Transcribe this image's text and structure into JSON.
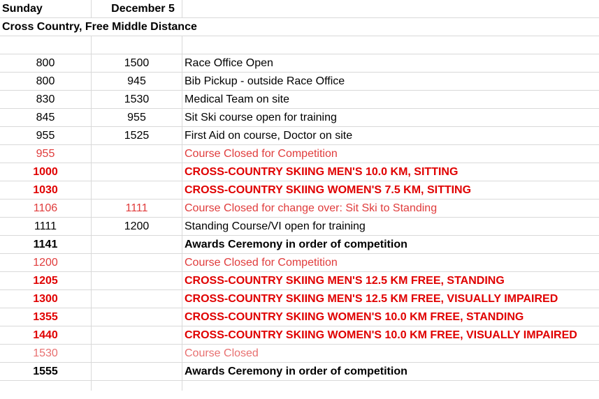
{
  "header": {
    "day": "Sunday",
    "date": "December 5"
  },
  "subtitle": "Cross Country, Free Middle Distance",
  "colors": {
    "black": "#000000",
    "red": "#e00000",
    "lightred": "#e03c3c",
    "pink": "#e87070"
  },
  "rows": [
    {
      "start": "800",
      "end": "1500",
      "event": "Race Office Open",
      "style": "black",
      "bold": false
    },
    {
      "start": "800",
      "end": "945",
      "event": "Bib Pickup - outside Race Office",
      "style": "black",
      "bold": false
    },
    {
      "start": "830",
      "end": "1530",
      "event": "Medical Team on site",
      "style": "black",
      "bold": false
    },
    {
      "start": "845",
      "end": "955",
      "event": "Sit Ski course open for training",
      "style": "black",
      "bold": false
    },
    {
      "start": "955",
      "end": "1525",
      "event": "First Aid on course, Doctor on site",
      "style": "black",
      "bold": false
    },
    {
      "start": "955",
      "end": "",
      "event": "Course Closed for Competition",
      "style": "lightred",
      "bold": false
    },
    {
      "start": "1000",
      "end": "",
      "event": "CROSS-COUNTRY SKIING MEN'S 10.0 KM, SITTING",
      "style": "red",
      "bold": true
    },
    {
      "start": "1030",
      "end": "",
      "event": "CROSS-COUNTRY SKIING WOMEN'S 7.5 KM, SITTING",
      "style": "red",
      "bold": true
    },
    {
      "start": "1106",
      "end": "1111",
      "event": "Course Closed for change over: Sit Ski to Standing",
      "style": "lightred",
      "bold": false
    },
    {
      "start": "1111",
      "end": "1200",
      "event": "Standing Course/VI open for training",
      "style": "black",
      "bold": false
    },
    {
      "start": "1141",
      "end": "",
      "event": "Awards Ceremony in order of competition",
      "style": "black",
      "bold": true
    },
    {
      "start": "1200",
      "end": "",
      "event": "Course Closed for Competition",
      "style": "lightred",
      "bold": false
    },
    {
      "start": "1205",
      "end": "",
      "event": "CROSS-COUNTRY SKIING MEN'S 12.5 KM FREE, STANDING",
      "style": "red",
      "bold": true
    },
    {
      "start": "1300",
      "end": "",
      "event": "CROSS-COUNTRY SKIING MEN'S 12.5 KM FREE, VISUALLY IMPAIRED",
      "style": "red",
      "bold": true
    },
    {
      "start": "1355",
      "end": "",
      "event": "CROSS-COUNTRY SKIING WOMEN'S 10.0 KM FREE, STANDING",
      "style": "red",
      "bold": true
    },
    {
      "start": "1440",
      "end": "",
      "event": "CROSS-COUNTRY SKIING WOMEN'S 10.0 KM FREE, VISUALLY IMPAIRED",
      "style": "red",
      "bold": true
    },
    {
      "start": "1530",
      "end": "",
      "event": "Course Closed",
      "style": "pink",
      "bold": false
    },
    {
      "start": "1555",
      "end": "",
      "event": "Awards Ceremony in order of competition",
      "style": "black",
      "bold": true
    }
  ]
}
